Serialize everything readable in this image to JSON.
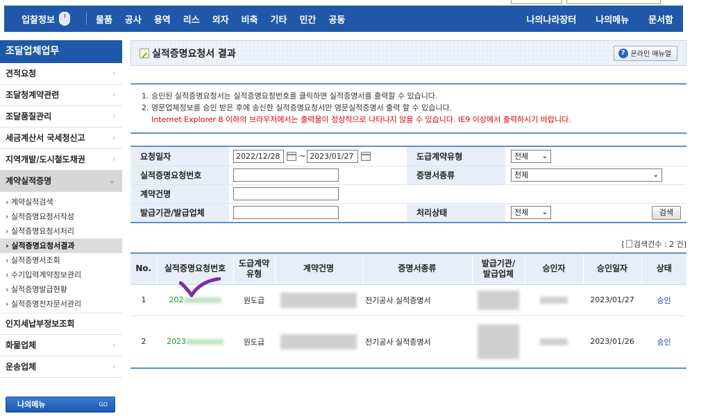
{
  "topnav": {
    "brand": "입찰정보",
    "menu": [
      "물품",
      "공사",
      "용역",
      "리스",
      "외자",
      "비축",
      "기타",
      "민간",
      "공동"
    ],
    "right": [
      "나의나라장터",
      "나의메뉴",
      "문서함"
    ]
  },
  "sidebar": {
    "title": "조달업체업무",
    "items_top": [
      "견적요청",
      "조달청계약관련",
      "조달품질관리",
      "세금계산서 국세청신고",
      "지역개발/도시철도채권",
      "계약실적증명"
    ],
    "sub_items": [
      "계약실적검색",
      "실적증명요청서작성",
      "실적증명요청서처리",
      "실적증명요청서결과",
      "실적증명서조회",
      "수기입력계약정보관리",
      "실적증명발급현황",
      "실적증명전자문서관리"
    ],
    "items_bottom": [
      "인지세납부정보조회",
      "화물업체",
      "운송업체"
    ],
    "my_menu": "나의메뉴",
    "my_menu_go": "GO"
  },
  "page": {
    "title": "실적증명요청서 결과",
    "manual_button": "온라인 매뉴얼"
  },
  "notice": {
    "line1": "1. 승인된 실적증명요청서는 실적증명요청번호를 클릭하면 실적증명서를 출력할 수 있습니다.",
    "line2": "2. 영문업체정보를 승인 받은 후에 송신한 실적증명요청서만 영문실적증명서 출력 할 수 있습니다.",
    "warning": "Internet Explorer 8 이하의 브라우저에서는 출력물이 정상적으로 나타나지 않을 수 있습니다. IE9 이상에서 출력하시기 바랍니다."
  },
  "search": {
    "request_date_label": "요청일자",
    "date_from": "2022/12/28",
    "date_sep": "~",
    "date_to": "2023/01/27",
    "contract_type_label": "도급계약유형",
    "contract_type_value": "전체",
    "request_no_label": "실적증명요청번호",
    "request_no_value": "",
    "cert_type_label": "증명서종류",
    "cert_type_value": "전체",
    "contract_name_label": "계약건명",
    "contract_name_value": "",
    "issuer_label": "발급기관/발급업체",
    "issuer_value": "",
    "status_label": "처리상태",
    "status_value": "전체",
    "search_button": "검색"
  },
  "count": {
    "prefix": "[",
    "label": "검색건수 : 2 건]"
  },
  "results": {
    "headers": [
      "No.",
      "실적증명요청번호",
      "도급계약유형",
      "계약건명",
      "증명서종류",
      "발급기관/발급업체",
      "승인자",
      "승인일자",
      "상태"
    ],
    "rows": [
      {
        "no": "1",
        "request_no": "202",
        "contract_type": "원도급",
        "cert_type": "전기공사 실적증명서",
        "approval_date": "2023/01/27",
        "status": "승인"
      },
      {
        "no": "2",
        "request_no": "2023",
        "contract_type": "원도급",
        "cert_type": "전기공사 실적증명서",
        "approval_date": "2023/01/26",
        "status": "승인"
      }
    ]
  },
  "colors": {
    "nav_blue": "#1f58a8",
    "table_border": "#5b8fcd",
    "label_bg": "#e8eef7",
    "warning_red": "#e00000",
    "link_green": "#238c3b",
    "status_blue": "#1c3dbd",
    "checkmark_purple": "#7a2fa8"
  }
}
